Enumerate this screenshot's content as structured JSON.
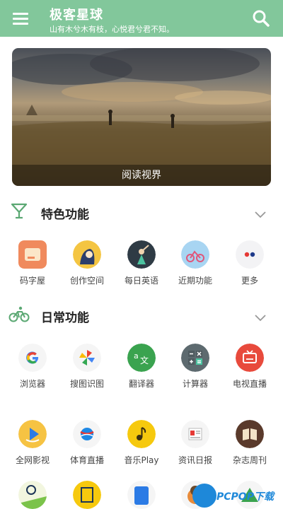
{
  "appbar": {
    "title": "极客星球",
    "subtitle": "山有木兮木有枝，心悦君兮君不知。",
    "menu_icon": "menu-icon",
    "search_icon": "search-icon",
    "color": "#82c79b"
  },
  "banner": {
    "caption": "阅读视界"
  },
  "featured": {
    "title": "特色功能",
    "icon": "cocktail-glass-icon",
    "items": [
      {
        "label": "码字屋",
        "icon": "note-icon"
      },
      {
        "label": "创作空间",
        "icon": "artist-icon"
      },
      {
        "label": "每日英语",
        "icon": "dancer-icon"
      },
      {
        "label": "近期功能",
        "icon": "bicycle-illustration-icon"
      },
      {
        "label": "更多",
        "icon": "more-dots-icon"
      }
    ]
  },
  "daily": {
    "title": "日常功能",
    "icon": "bicycle-icon",
    "row1": [
      {
        "label": "浏览器",
        "icon": "google-icon"
      },
      {
        "label": "搜图识图",
        "icon": "pinwheel-icon"
      },
      {
        "label": "翻译器",
        "icon": "translate-icon"
      },
      {
        "label": "计算器",
        "icon": "calculator-icon"
      },
      {
        "label": "电视直播",
        "icon": "tv-icon"
      }
    ],
    "row2": [
      {
        "label": "全网影视",
        "icon": "play-icon"
      },
      {
        "label": "体育直播",
        "icon": "ball-icon"
      },
      {
        "label": "音乐Play",
        "icon": "music-note-icon"
      },
      {
        "label": "资讯日报",
        "icon": "newspaper-icon"
      },
      {
        "label": "杂志周刊",
        "icon": "book-icon"
      }
    ]
  },
  "watermark": {
    "text": "PCPOP下载"
  }
}
